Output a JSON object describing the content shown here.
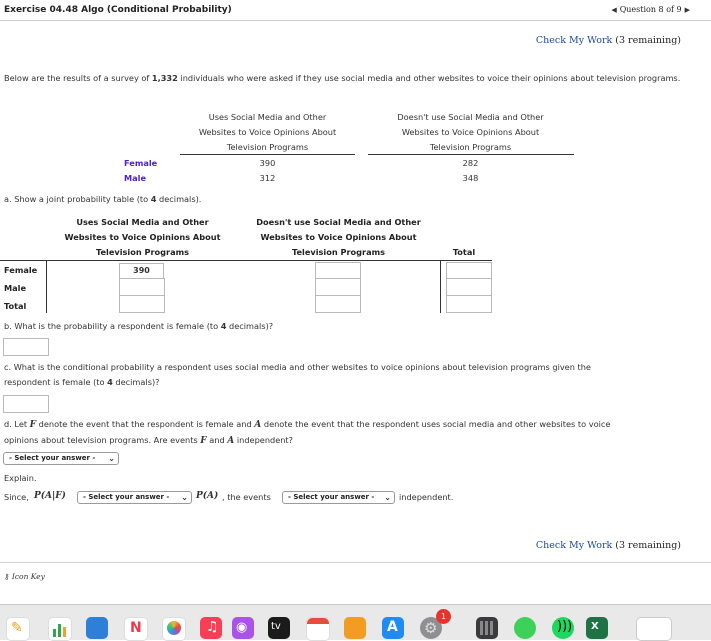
{
  "header": {
    "title": "Exercise 04.48 Algo (Conditional Probability)",
    "question_nav": "Question 8 of 9"
  },
  "check": {
    "label": "Check My Work",
    "remaining": "(3 remaining)"
  },
  "intro": {
    "pre": "Below are the results of a survey of ",
    "count": "1,332",
    "post": " individuals who were asked if they use social media and other websites to voice their opinions about television programs."
  },
  "survey_table": {
    "col1": [
      "Uses Social Media and Other",
      "Websites to Voice Opinions About",
      "Television Programs"
    ],
    "col2": [
      "Doesn't use Social Media and Other",
      "Websites to Voice Opinions About",
      "Television Programs"
    ],
    "rows": [
      {
        "label": "Female",
        "v1": "390",
        "v2": "282"
      },
      {
        "label": "Male",
        "v1": "312",
        "v2": "348"
      }
    ]
  },
  "part_a": {
    "prompt_pre": "a. Show a joint probability table (to ",
    "decimals": "4",
    "prompt_post": " decimals).",
    "col1": [
      "Uses Social Media and Other",
      "Websites to Voice Opinions About",
      "Television Programs"
    ],
    "col2": [
      "Doesn't use Social Media and Other",
      "Websites to Voice Opinions About",
      "Television Programs"
    ],
    "col3": "Total",
    "row_labels": [
      "Female",
      "Male",
      "Total"
    ],
    "prefilled": "390"
  },
  "part_b": {
    "pre": "b. What is the probability a respondent is female (to ",
    "decimals": "4",
    "post": " decimals)?"
  },
  "part_c": {
    "line1": "c. What is the conditional probability a respondent uses social media and other websites to voice opinions about television programs given the",
    "line2_pre": "respondent is female (to ",
    "decimals": "4",
    "line2_post": " decimals)?"
  },
  "part_d": {
    "l1_pre": "d. Let ",
    "F": "F",
    "l1_mid": " denote the event that the respondent is female and ",
    "A": "A",
    "l1_post": " denote the event that the respondent uses social media and other websites to voice",
    "l2_pre": "opinions about television programs. Are events ",
    "l2_and": " and ",
    "l2_post": " independent?",
    "select1": "- Select your answer -",
    "explain": "Explain.",
    "since": "Since,",
    "pa_given_f": "P(A|F)",
    "select2": "- Select your answer -",
    "pa": "P(A)",
    "the_events": ", the events",
    "select3": "- Select your answer -",
    "independent": "independent."
  },
  "icon_key": "Icon Key",
  "dock": {
    "apps": [
      "pages",
      "numbers",
      "keynote",
      "news",
      "photos",
      "music",
      "podcasts",
      "tv",
      "calendar",
      "books",
      "app-store",
      "system-preferences",
      "calculator",
      "messages",
      "spotify",
      "excel",
      "preview"
    ],
    "badge": "1",
    "tv_label": "tv"
  }
}
